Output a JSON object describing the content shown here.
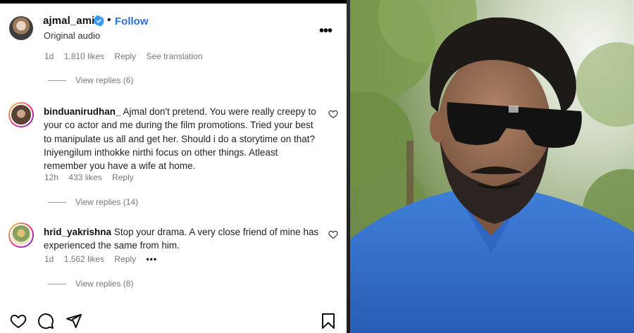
{
  "post": {
    "username": "ajmal_amir",
    "follow_label": "Follow",
    "audio_label": "Original audio",
    "more_label": "•••"
  },
  "top_comment_meta": {
    "time": "1d",
    "likes": "1,810 likes",
    "reply": "Reply",
    "translation": "See translation",
    "view_replies": "View replies (6)"
  },
  "comments": [
    {
      "username": "binduanirudhan_",
      "text": "Ajmal don't pretend. You were really creepy to your co actor and me during the film promotions. Tried your best to manipulate us all and get her. Should i do a storytime on that? Iniyengilum inthokke nirthi focus on other things. Atleast remember you have a wife at home.",
      "time": "12h",
      "likes": "433 likes",
      "reply": "Reply",
      "view_replies": "View replies (14)"
    },
    {
      "username": "hrid_yakrishna",
      "text": "Stop your drama. A very close friend of mine has experienced the same from him.",
      "time": "1d",
      "likes": "1,562 likes",
      "reply": "Reply",
      "more": "•••",
      "view_replies": "View replies (8)"
    }
  ],
  "colors": {
    "follow_blue": "#2d6fe0",
    "verified_blue": "#3897f0"
  },
  "icons": [
    "verified-badge-icon",
    "more-options-icon",
    "heart-icon",
    "like-icon",
    "comment-icon",
    "share-icon",
    "save-icon"
  ]
}
